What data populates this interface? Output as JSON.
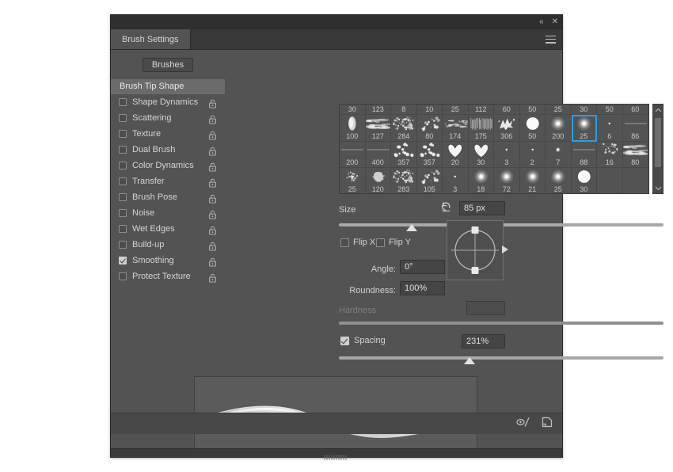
{
  "window": {
    "collapse_label": "«",
    "close_label": "✕",
    "menu_icon": "hamburger-menu-icon"
  },
  "tabs": [
    {
      "label": "Brush Settings",
      "active": true
    }
  ],
  "sidebar": {
    "brushes_button": "Brushes",
    "header": "Brush Tip Shape",
    "items": [
      {
        "label": "Shape Dynamics",
        "checked": false,
        "locked": true
      },
      {
        "label": "Scattering",
        "checked": false,
        "locked": true
      },
      {
        "label": "Texture",
        "checked": false,
        "locked": true
      },
      {
        "label": "Dual Brush",
        "checked": false,
        "locked": true
      },
      {
        "label": "Color Dynamics",
        "checked": false,
        "locked": true
      },
      {
        "label": "Transfer",
        "checked": false,
        "locked": true
      },
      {
        "label": "Brush Pose",
        "checked": false,
        "locked": true
      },
      {
        "label": "Noise",
        "checked": false,
        "locked": true
      },
      {
        "label": "Wet Edges",
        "checked": false,
        "locked": true
      },
      {
        "label": "Build-up",
        "checked": false,
        "locked": true
      },
      {
        "label": "Smoothing",
        "checked": true,
        "locked": true
      },
      {
        "label": "Protect Texture",
        "checked": false,
        "locked": true
      }
    ]
  },
  "brush_grid": {
    "selected_index": 21,
    "scroll_up_icon": "chevron-up-icon",
    "scroll_down_icon": "chevron-down-icon",
    "rows": [
      {
        "cells": [
          {
            "size": "30",
            "kind": "blank"
          },
          {
            "size": "123",
            "kind": "blank"
          },
          {
            "size": "8",
            "kind": "blank"
          },
          {
            "size": "10",
            "kind": "blank"
          },
          {
            "size": "25",
            "kind": "blank"
          },
          {
            "size": "112",
            "kind": "blank"
          },
          {
            "size": "60",
            "kind": "blank"
          },
          {
            "size": "50",
            "kind": "blank"
          },
          {
            "size": "25",
            "kind": "blank"
          },
          {
            "size": "30",
            "kind": "blank"
          },
          {
            "size": "50",
            "kind": "blank"
          },
          {
            "size": "60",
            "kind": "blank"
          }
        ]
      },
      {
        "cells": [
          {
            "size": "100",
            "kind": "blob"
          },
          {
            "size": "127",
            "kind": "scratch"
          },
          {
            "size": "284",
            "kind": "spatter"
          },
          {
            "size": "80",
            "kind": "sparse"
          },
          {
            "size": "174",
            "kind": "smear"
          },
          {
            "size": "175",
            "kind": "hair"
          },
          {
            "size": "306",
            "kind": "splat"
          },
          {
            "size": "50",
            "kind": "hard-round"
          },
          {
            "size": "200",
            "kind": "soft-round"
          },
          {
            "size": "25",
            "kind": "soft-round"
          },
          {
            "size": "6",
            "kind": "tiny-dot"
          },
          {
            "size": "86",
            "kind": "line"
          }
        ]
      },
      {
        "cells": [
          {
            "size": "200",
            "kind": "line"
          },
          {
            "size": "400",
            "kind": "line"
          },
          {
            "size": "357",
            "kind": "dots"
          },
          {
            "size": "357",
            "kind": "dots"
          },
          {
            "size": "20",
            "kind": "heart"
          },
          {
            "size": "30",
            "kind": "heart"
          },
          {
            "size": "3",
            "kind": "tiny-dot"
          },
          {
            "size": "2",
            "kind": "tiny-dot"
          },
          {
            "size": "7",
            "kind": "small-soft"
          },
          {
            "size": "88",
            "kind": "line"
          },
          {
            "size": "16",
            "kind": "sparkle"
          },
          {
            "size": "80",
            "kind": "scratch"
          }
        ]
      },
      {
        "cells": [
          {
            "size": "25",
            "kind": "fuzz"
          },
          {
            "size": "120",
            "kind": "crumple"
          },
          {
            "size": "283",
            "kind": "spatter"
          },
          {
            "size": "105",
            "kind": "sparse"
          },
          {
            "size": "3",
            "kind": "tiny-dot"
          },
          {
            "size": "18",
            "kind": "soft-round"
          },
          {
            "size": "72",
            "kind": "soft-round"
          },
          {
            "size": "21",
            "kind": "soft-round"
          },
          {
            "size": "25",
            "kind": "soft-round"
          },
          {
            "size": "30",
            "kind": "hard-round"
          },
          {
            "size": "",
            "kind": "empty"
          },
          {
            "size": "",
            "kind": "empty"
          }
        ]
      }
    ]
  },
  "controls": {
    "size": {
      "label": "Size",
      "value": "85 px",
      "reset_icon": "reset-arrow-icon",
      "slider_percent": 31
    },
    "flip_x": {
      "label": "Flip X",
      "checked": false
    },
    "flip_y": {
      "label": "Flip Y",
      "checked": false
    },
    "angle": {
      "label": "Angle:",
      "value": "0°"
    },
    "roundness": {
      "label": "Roundness:",
      "value": "100%"
    },
    "hardness": {
      "label": "Hardness",
      "value": "",
      "disabled": true,
      "slider_percent": 0
    },
    "spacing": {
      "label": "Spacing",
      "value": "231%",
      "checked": true,
      "slider_percent": 51
    }
  },
  "footer": {
    "toggle_icon": "brush-pressure-icon",
    "new_brush_icon": "new-brush-page-icon",
    "resize_grip_icon": "resize-grip-icon"
  }
}
